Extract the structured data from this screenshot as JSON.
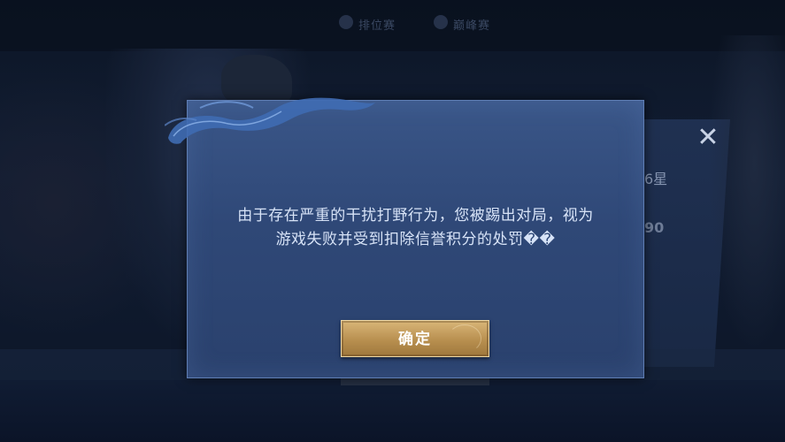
{
  "background": {
    "top_tabs": [
      "排位赛",
      "巅峰赛"
    ],
    "rank_fragment": "6星",
    "score_fragment": "90",
    "close_icon": "close-icon"
  },
  "dialog": {
    "message_lines": [
      "由于存在严重的干扰打野行为，您被踢出对局，视为",
      "游戏失败并受到扣除信誉积分的处罚��"
    ],
    "confirm_label": "确定"
  },
  "colors": {
    "dialog_bg": "#2f4877",
    "dialog_border": "#5f7eb4",
    "button_gold": "#c9a263",
    "text": "#d7e3f7"
  }
}
